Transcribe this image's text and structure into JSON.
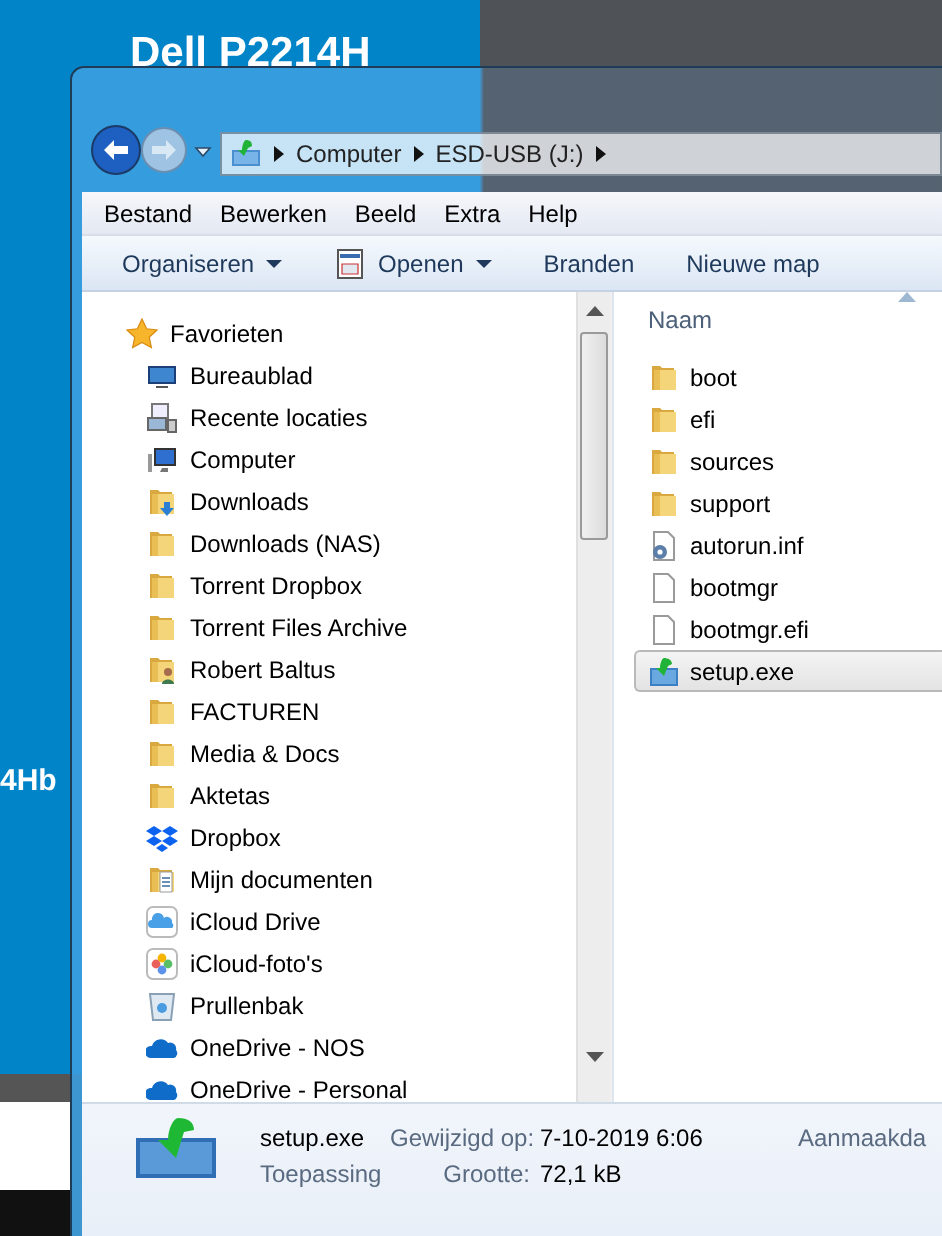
{
  "desktop": {
    "texts": [
      {
        "text": "Dell P2214H",
        "kind": "title"
      },
      {
        "text": "4Hb",
        "kind": "side"
      }
    ]
  },
  "window": {
    "navigation_buttons": {
      "back_enabled": true,
      "forward_enabled": false
    },
    "address_bar": {
      "segments": [
        "Computer",
        "ESD-USB (J:)"
      ]
    },
    "menu": [
      "Bestand",
      "Bewerken",
      "Beeld",
      "Extra",
      "Help"
    ],
    "toolbar": [
      {
        "label": "Organiseren",
        "kind": "dropdown"
      },
      {
        "label": "Openen",
        "kind": "app-dropdown"
      },
      {
        "label": "Branden",
        "kind": "plain"
      },
      {
        "label": "Nieuwe map",
        "kind": "plain"
      }
    ],
    "navigation": [
      {
        "label": "Favorieten",
        "kind": "star",
        "children": [
          {
            "label": "Bureaublad",
            "kind": "desktop"
          },
          {
            "label": "Recente locaties",
            "kind": "recent"
          },
          {
            "label": "Computer",
            "kind": "computer"
          },
          {
            "label": "Downloads",
            "kind": "download-folder"
          },
          {
            "label": "Downloads (NAS)",
            "kind": "folder"
          },
          {
            "label": "Torrent Dropbox",
            "kind": "folder"
          },
          {
            "label": "Torrent Files Archive",
            "kind": "folder"
          },
          {
            "label": "Robert Baltus",
            "kind": "user-folder"
          },
          {
            "label": "FACTUREN",
            "kind": "folder"
          },
          {
            "label": "Media & Docs",
            "kind": "folder"
          },
          {
            "label": "Aktetas",
            "kind": "folder"
          },
          {
            "label": "Dropbox",
            "kind": "dropbox"
          },
          {
            "label": "Mijn documenten",
            "kind": "docs-folder"
          },
          {
            "label": "iCloud Drive",
            "kind": "icloud"
          },
          {
            "label": "iCloud-foto's",
            "kind": "photos"
          },
          {
            "label": "Prullenbak",
            "kind": "bin"
          },
          {
            "label": "OneDrive - NOS",
            "kind": "onedrive"
          },
          {
            "label": "OneDrive - Personal",
            "kind": "onedrive"
          }
        ]
      }
    ],
    "files": {
      "column": "Naam",
      "items": [
        {
          "name": "boot",
          "kind": "folder",
          "selected": false
        },
        {
          "name": "efi",
          "kind": "folder",
          "selected": false
        },
        {
          "name": "sources",
          "kind": "folder",
          "selected": false
        },
        {
          "name": "support",
          "kind": "folder",
          "selected": false
        },
        {
          "name": "autorun.inf",
          "kind": "settings-file",
          "selected": false
        },
        {
          "name": "bootmgr",
          "kind": "file",
          "selected": false
        },
        {
          "name": "bootmgr.efi",
          "kind": "file",
          "selected": false
        },
        {
          "name": "setup.exe",
          "kind": "installer",
          "selected": true
        }
      ]
    },
    "details": {
      "name": "setup.exe",
      "type": "Toepassing",
      "fields": [
        {
          "label": "Gewijzigd op:",
          "value": "7-10-2019 6:06"
        },
        {
          "label": "Grootte:",
          "value": "72,1 kB"
        }
      ],
      "extra_label": "Aanmaakda"
    }
  }
}
